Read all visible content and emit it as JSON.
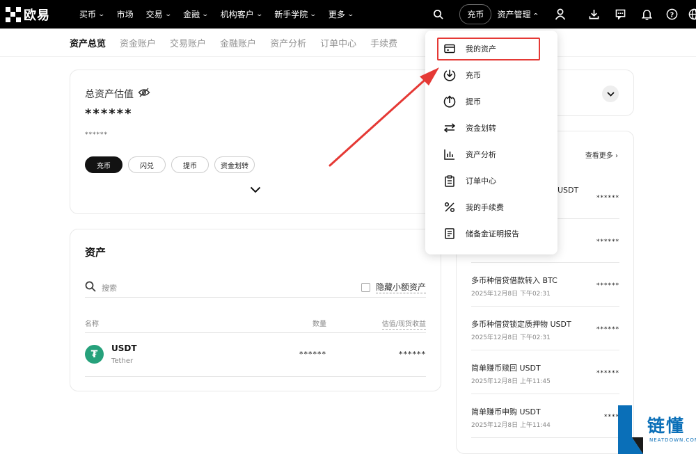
{
  "brand": {
    "logo_text": "欧易"
  },
  "topnav": {
    "items": [
      "买币",
      "市场",
      "交易",
      "金融",
      "机构客户",
      "新手学院",
      "更多"
    ],
    "deposit_label": "充币",
    "asset_mgmt_label": "资产管理"
  },
  "subtabs": [
    "资产总览",
    "资金账户",
    "交易账户",
    "金融账户",
    "资产分析",
    "订单中心",
    "手续费"
  ],
  "overview": {
    "title": "总资产估值",
    "masked_value": "******",
    "masked_sub": "******",
    "buttons": [
      "充币",
      "闪兑",
      "提币",
      "资金划转"
    ]
  },
  "assets": {
    "title": "资产",
    "search_placeholder": "搜索",
    "hide_small_label": "隐藏小额资产",
    "col_name": "名称",
    "col_qty": "数量",
    "col_value": "估值/现货收益",
    "rows": [
      {
        "symbol": "USDT",
        "name": "Tether",
        "qty": "******",
        "value": "******"
      }
    ]
  },
  "records": {
    "see_more": "查看更多",
    "items": [
      {
        "title": "USDT",
        "time": "",
        "value": "******"
      },
      {
        "title": "",
        "time": "",
        "value": "******"
      },
      {
        "title": "多币种借贷借款转入 BTC",
        "time": "2025年12月8日 下午02:31",
        "value": "******"
      },
      {
        "title": "多币种借贷锁定质押物 USDT",
        "time": "2025年12月8日 下午02:31",
        "value": "******"
      },
      {
        "title": "简单赚币赎回 USDT",
        "time": "2025年12月8日 上午11:45",
        "value": "******"
      },
      {
        "title": "简单赚币申购 USDT",
        "time": "2025年12月8日 上午11:44",
        "value": "****"
      }
    ]
  },
  "dropdown": {
    "items": [
      {
        "label": "我的资产",
        "icon": "wallet-icon"
      },
      {
        "label": "充币",
        "icon": "deposit-icon"
      },
      {
        "label": "提币",
        "icon": "withdraw-icon"
      },
      {
        "label": "资金划转",
        "icon": "transfer-icon"
      },
      {
        "label": "资产分析",
        "icon": "chart-icon"
      },
      {
        "label": "订单中心",
        "icon": "clipboard-icon"
      },
      {
        "label": "我的手续费",
        "icon": "percent-icon"
      },
      {
        "label": "储备金证明报告",
        "icon": "report-icon"
      }
    ]
  },
  "watermark": {
    "text": "链懂",
    "sub": "NEATDOWN.COM"
  },
  "colors": {
    "accent_red": "#e53935",
    "watermark_blue": "#0a6fb8",
    "usdt_green": "#26a17b"
  }
}
